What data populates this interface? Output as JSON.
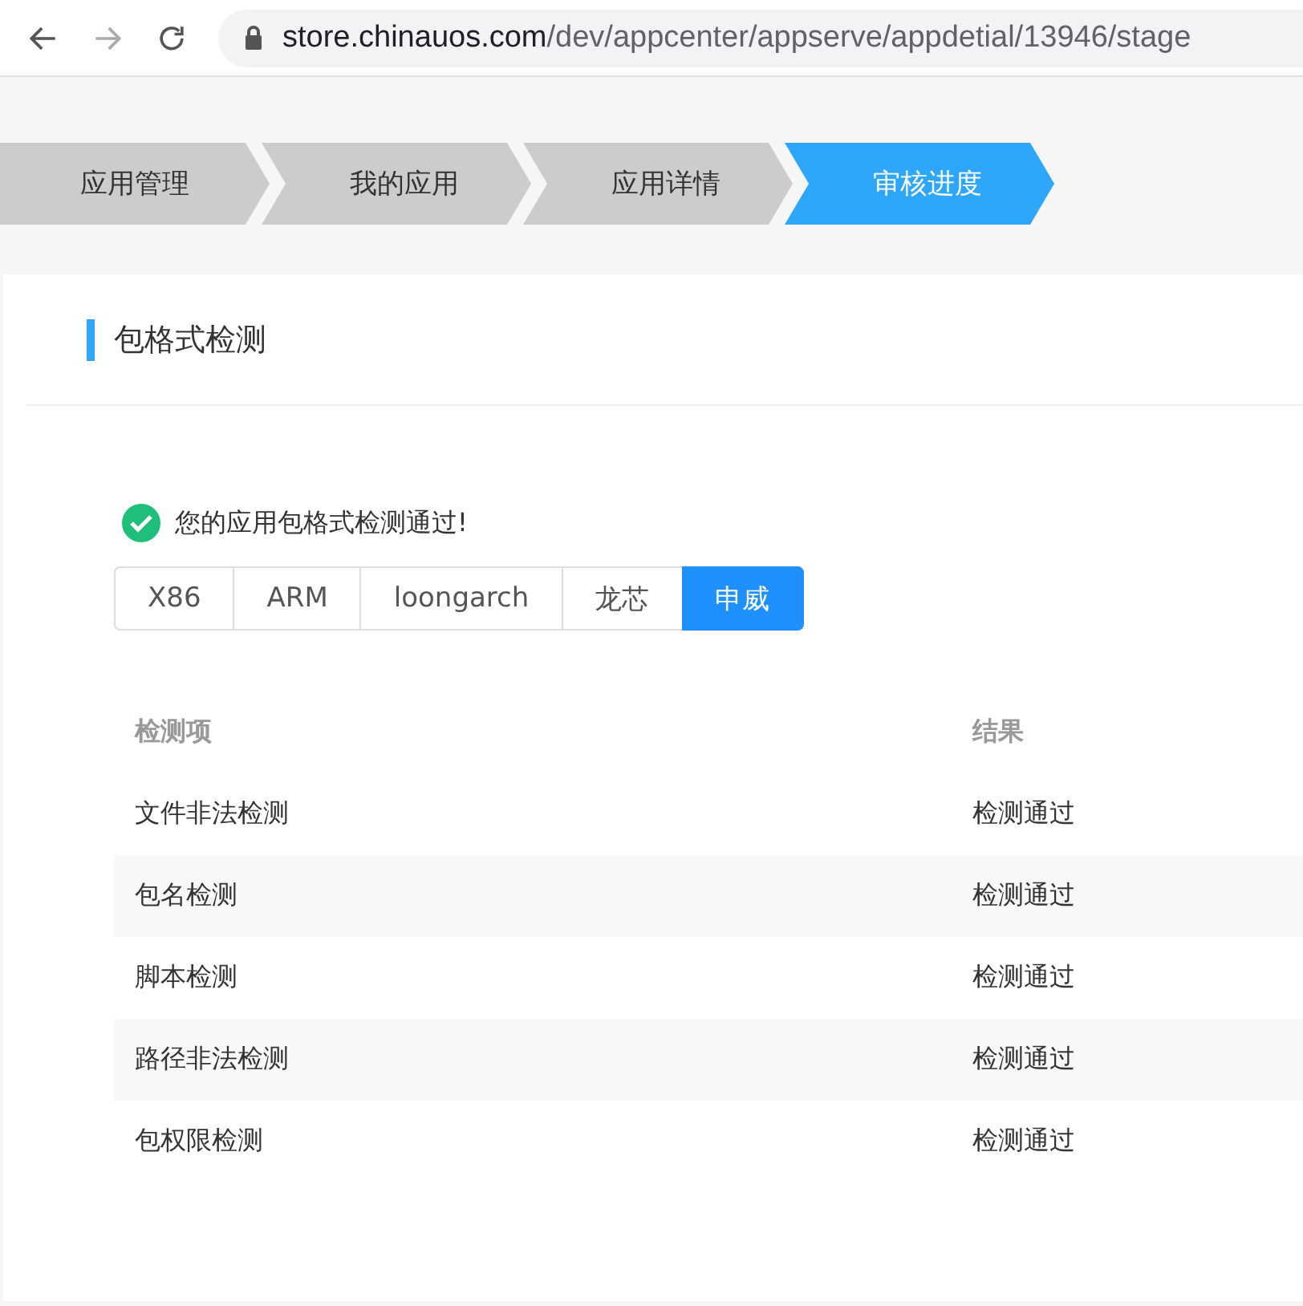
{
  "browser": {
    "url_host": "store.chinauos.com",
    "url_path": "/dev/appcenter/appserve/appdetial/13946/stage"
  },
  "breadcrumb": [
    {
      "label": "应用管理",
      "selected": false
    },
    {
      "label": "我的应用",
      "selected": false
    },
    {
      "label": "应用详情",
      "selected": false
    },
    {
      "label": "审核进度",
      "selected": true
    }
  ],
  "section": {
    "title": "包格式检测"
  },
  "result_message": "您的应用包格式检测通过!",
  "arch_tabs": [
    {
      "label": "X86",
      "selected": false
    },
    {
      "label": "ARM",
      "selected": false
    },
    {
      "label": "loongarch",
      "selected": false
    },
    {
      "label": "龙芯",
      "selected": false
    },
    {
      "label": "申威",
      "selected": true
    }
  ],
  "table": {
    "columns": [
      "检测项",
      "结果"
    ],
    "rows": [
      [
        "文件非法检测",
        "检测通过"
      ],
      [
        "包名检测",
        "检测通过"
      ],
      [
        "脚本检测",
        "检测通过"
      ],
      [
        "路径非法检测",
        "检测通过"
      ],
      [
        "包权限检测",
        "检测通过"
      ]
    ]
  }
}
